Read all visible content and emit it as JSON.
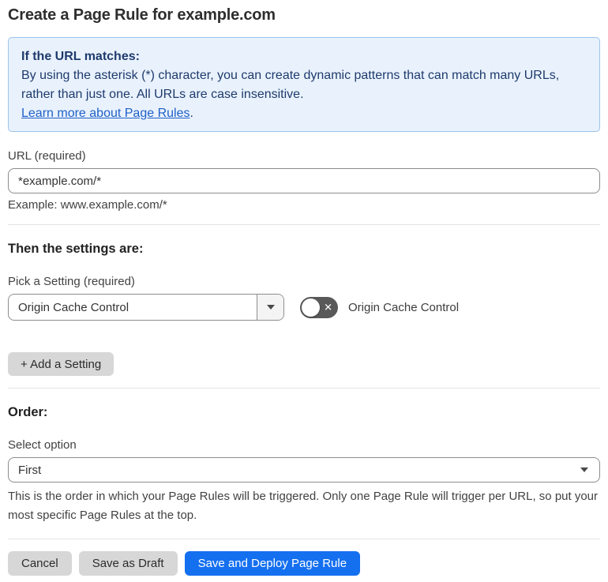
{
  "page": {
    "title": "Create a Page Rule for example.com"
  },
  "info_box": {
    "heading": "If the URL matches:",
    "body": "By using the asterisk (*) character, you can create dynamic patterns that can match many URLs, rather than just one. All URLs are case insensitive.",
    "link_label": "Learn more about Page Rules",
    "link_suffix": "."
  },
  "url_field": {
    "label": "URL (required)",
    "value": "*example.com/*",
    "example": "Example: www.example.com/*"
  },
  "settings_section": {
    "heading": "Then the settings are:",
    "picker_label": "Pick a Setting (required)",
    "selected_setting": "Origin Cache Control",
    "toggle_label": "Origin Cache Control",
    "toggle_state": "off",
    "add_setting_label": "+ Add a Setting"
  },
  "order_section": {
    "heading": "Order:",
    "select_label": "Select option",
    "selected_option": "First",
    "help_text": "This is the order in which your Page Rules will be triggered. Only one Page Rule will trigger per URL, so put your most specific Page Rules at the top."
  },
  "footer": {
    "cancel_label": "Cancel",
    "save_draft_label": "Save as Draft",
    "save_deploy_label": "Save and Deploy Page Rule"
  },
  "icons": {
    "caret_down": "▼",
    "toggle_off_glyph": "✕"
  },
  "colors": {
    "info_box_bg": "#e9f2fc",
    "info_box_border": "#9cc2ed",
    "info_text": "#1e3a6d",
    "link": "#1f60c8",
    "primary_button": "#1570f0",
    "secondary_button": "#d7d7d7",
    "toggle_off_bg": "#595959",
    "input_border": "#8d8d8d"
  }
}
